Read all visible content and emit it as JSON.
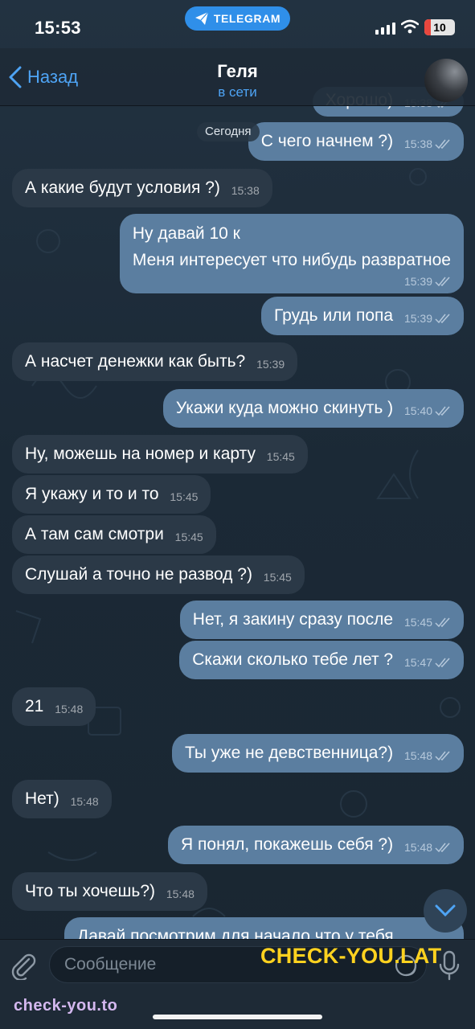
{
  "status_bar": {
    "time": "15:53",
    "app_pill": "TELEGRAM",
    "battery": "10"
  },
  "header": {
    "back_label": "Назад",
    "contact_name": "Геля",
    "contact_status": "в сети"
  },
  "date_separator": "Сегодня",
  "messages": [
    {
      "dir": "out",
      "text": "Хорошо)",
      "time": "15:38",
      "partial": true
    },
    {
      "dir": "out",
      "text": "С чего начнем ?)",
      "time": "15:38"
    },
    {
      "dir": "in",
      "text": "А какие будут условия ?)",
      "time": "15:38"
    },
    {
      "dir": "out",
      "lines": [
        "Ну давай 10 к",
        "Меня интересует что нибудь развратное"
      ],
      "time": "15:39"
    },
    {
      "dir": "out",
      "text": "Грудь или попа",
      "time": "15:39"
    },
    {
      "dir": "in",
      "text": "А насчет денежки как быть?",
      "time": "15:39"
    },
    {
      "dir": "out",
      "text": "Укажи куда можно скинуть )",
      "time": "15:40"
    },
    {
      "dir": "in",
      "text": "Ну, можешь на номер и карту",
      "time": "15:45"
    },
    {
      "dir": "in",
      "text": "Я укажу и то и то",
      "time": "15:45"
    },
    {
      "dir": "in",
      "text": "А там сам смотри",
      "time": "15:45"
    },
    {
      "dir": "in",
      "text": "Слушай а точно не развод ?)",
      "time": "15:45"
    },
    {
      "dir": "out",
      "text": "Нет, я закину сразу после",
      "time": "15:45"
    },
    {
      "dir": "out",
      "text": "Скажи сколько тебе лет ?",
      "time": "15:47"
    },
    {
      "dir": "in",
      "text": "21",
      "time": "15:48"
    },
    {
      "dir": "out",
      "text": "Ты уже не девственница?)",
      "time": "15:48"
    },
    {
      "dir": "in",
      "text": "Нет)",
      "time": "15:48"
    },
    {
      "dir": "out",
      "text": "Я понял, покажешь себя ?)",
      "time": "15:48"
    },
    {
      "dir": "in",
      "text": "Что ты хочешь?)",
      "time": "15:48"
    },
    {
      "dir": "out",
      "text": "Давай посмотрим для начало что у тебя",
      "time": "",
      "partial": true
    }
  ],
  "input": {
    "placeholder": "Сообщение"
  },
  "watermarks": {
    "big": "CHECK-YOU.LAT",
    "small": "check-you.to"
  },
  "colors": {
    "accent": "#4ea4f5",
    "incoming_bubble": "#2b3947",
    "outgoing_bubble": "#5b7ea0",
    "telegram_pill": "#2f8fe9",
    "watermark_yellow": "#ffd21f"
  },
  "icons": {
    "back": "chevron-left-icon",
    "telegram": "paper-plane-icon",
    "attach": "paperclip-icon",
    "sticker": "sticker-icon",
    "mic": "microphone-icon",
    "scroll_down": "chevron-down-icon",
    "read": "double-check-icon"
  }
}
